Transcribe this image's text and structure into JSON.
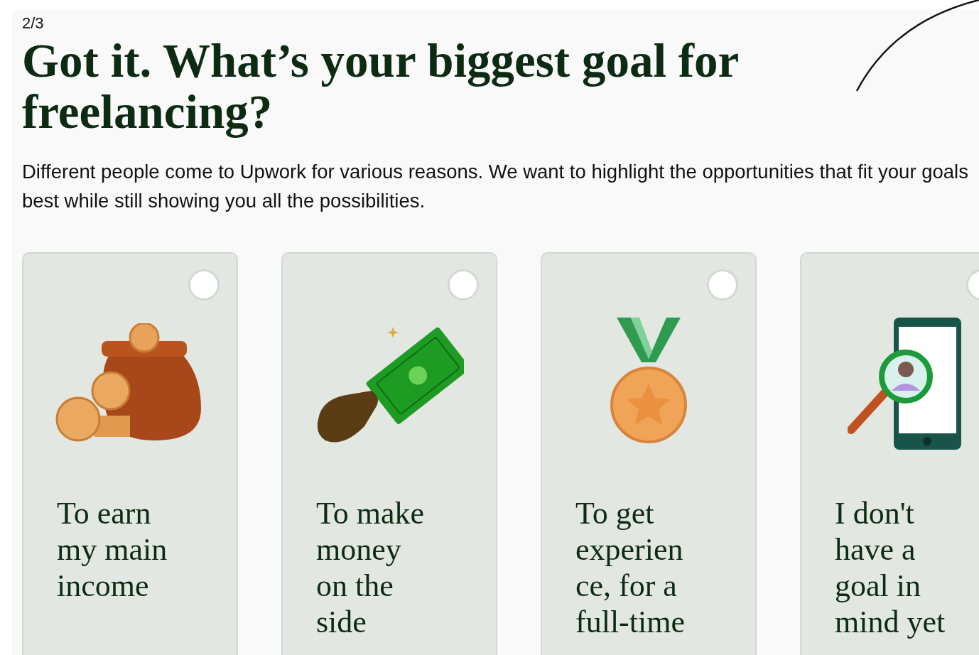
{
  "step": "2/3",
  "title": "Got it. What’s your biggest goal for freelancing?",
  "description": "Different people come to Upwork for various reasons. We want to highlight the opportunities that fit your goals best while still showing you all the possibilities.",
  "options": [
    {
      "kind": "pot",
      "lines": [
        "To earn",
        "my main",
        "income"
      ],
      "selected": false
    },
    {
      "kind": "cash",
      "lines": [
        "To make",
        "money",
        "on the",
        "side"
      ],
      "selected": false
    },
    {
      "kind": "medal",
      "lines": [
        "To get",
        "experien",
        "ce, for a",
        "full-time"
      ],
      "selected": false
    },
    {
      "kind": "phone",
      "lines": [
        "I don't",
        "have a",
        "goal in",
        "mind yet"
      ],
      "selected": false
    }
  ]
}
